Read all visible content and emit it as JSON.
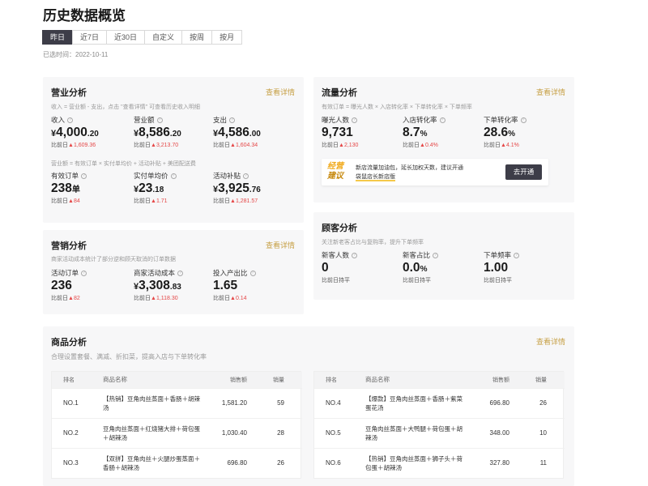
{
  "page_title": "历史数据概览",
  "tabs": [
    {
      "label": "昨日",
      "active": true
    },
    {
      "label": "近7日",
      "active": false
    },
    {
      "label": "近30日",
      "active": false
    },
    {
      "label": "自定义",
      "active": false
    },
    {
      "label": "按周",
      "active": false
    },
    {
      "label": "按月",
      "active": false
    }
  ],
  "selected_time": "已选时间：2022-10-11",
  "detail_link": "查看详情",
  "compare_prefix": "比前日",
  "revenue": {
    "title": "营业分析",
    "desc1": "收入 = 营业额 - 支出，点击 \"查看详情\" 可查看历史收入明细",
    "desc2": "营业额 = 有效订单 × 实付单均价 + 活动补贴 + 美团配送费",
    "metrics": [
      {
        "label": "收入",
        "currency": "¥",
        "int": "4,000",
        "dec": ".20",
        "change": "1,609.36"
      },
      {
        "label": "营业额",
        "currency": "¥",
        "int": "8,586",
        "dec": ".20",
        "change": "3,213.70"
      },
      {
        "label": "支出",
        "currency": "¥",
        "int": "4,586",
        "dec": ".00",
        "change": "1,604.34"
      },
      {
        "label": "有效订单",
        "currency": "",
        "int": "238",
        "dec": "单",
        "change": "84"
      },
      {
        "label": "实付单均价",
        "currency": "¥",
        "int": "23",
        "dec": ".18",
        "change": "1.71"
      },
      {
        "label": "活动补贴",
        "currency": "¥",
        "int": "3,925",
        "dec": ".76",
        "change": "1,281.57"
      }
    ]
  },
  "traffic": {
    "title": "流量分析",
    "desc": "有效订单 = 曝光人数 × 入店转化率 × 下单转化率 × 下单频率",
    "metrics": [
      {
        "label": "曝光人数",
        "int": "9,731",
        "dec": "",
        "change": "2,130"
      },
      {
        "label": "入店转化率",
        "int": "8.7",
        "dec": "%",
        "change": "0.4%"
      },
      {
        "label": "下单转化率",
        "int": "28.6",
        "dec": "%",
        "change": "4.1%"
      }
    ],
    "promo": {
      "logo_line1": "经营",
      "logo_line2": "建议",
      "text_plain": "新店流量加油包，延长加权天数，建议开通",
      "text_highlight": "袋鼠店长新店版",
      "button": "去开通"
    }
  },
  "marketing": {
    "title": "营销分析",
    "desc": "商家活动成本统计了部分逆和顾天取消的订单数据",
    "metrics": [
      {
        "label": "活动订单",
        "currency": "",
        "int": "236",
        "dec": "",
        "change": "82"
      },
      {
        "label": "商家活动成本",
        "currency": "¥",
        "int": "3,308",
        "dec": ".83",
        "change": "1,118.30"
      },
      {
        "label": "投入产出比",
        "currency": "",
        "int": "1.65",
        "dec": "",
        "change": "0.14"
      }
    ]
  },
  "customer": {
    "title": "顾客分析",
    "desc": "关注新老客占比与复购率，提升下单频率",
    "metrics": [
      {
        "label": "新客人数",
        "int": "0",
        "dec": "",
        "change": "持平"
      },
      {
        "label": "新客占比",
        "int": "0.0",
        "dec": "%",
        "change": "持平"
      },
      {
        "label": "下单频率",
        "int": "1.00",
        "dec": "",
        "change": "持平"
      }
    ]
  },
  "products": {
    "title": "商品分析",
    "desc": "合理设置套餐、满减、折扣菜，提高入店与下单转化率",
    "headers": [
      "排名",
      "商品名称",
      "销售额",
      "销量"
    ],
    "left_rows": [
      {
        "rank": "NO.1",
        "name": "【热销】豆角肉丝蒸面＋香肠＋胡辣汤",
        "sales": "1,581.20",
        "qty": "59"
      },
      {
        "rank": "NO.2",
        "name": "豆角肉丝蒸面＋红烧猪大排＋荷包蛋＋胡辣汤",
        "sales": "1,030.40",
        "qty": "28"
      },
      {
        "rank": "NO.3",
        "name": "【双拼】豆角肉丝＋火腿炒蛋蒸面＋香肠＋胡辣汤",
        "sales": "696.80",
        "qty": "26"
      }
    ],
    "right_rows": [
      {
        "rank": "NO.4",
        "name": "【爆款】豆角肉丝蒸面＋香肠＋紫菜蛋花汤",
        "sales": "696.80",
        "qty": "26"
      },
      {
        "rank": "NO.5",
        "name": "豆角肉丝蒸面＋大鸭腿＋荷包蛋＋胡辣汤",
        "sales": "348.00",
        "qty": "10"
      },
      {
        "rank": "NO.6",
        "name": "【热销】豆角肉丝蒸面＋狮子头＋荷包蛋＋胡辣汤",
        "sales": "327.80",
        "qty": "11"
      }
    ]
  }
}
